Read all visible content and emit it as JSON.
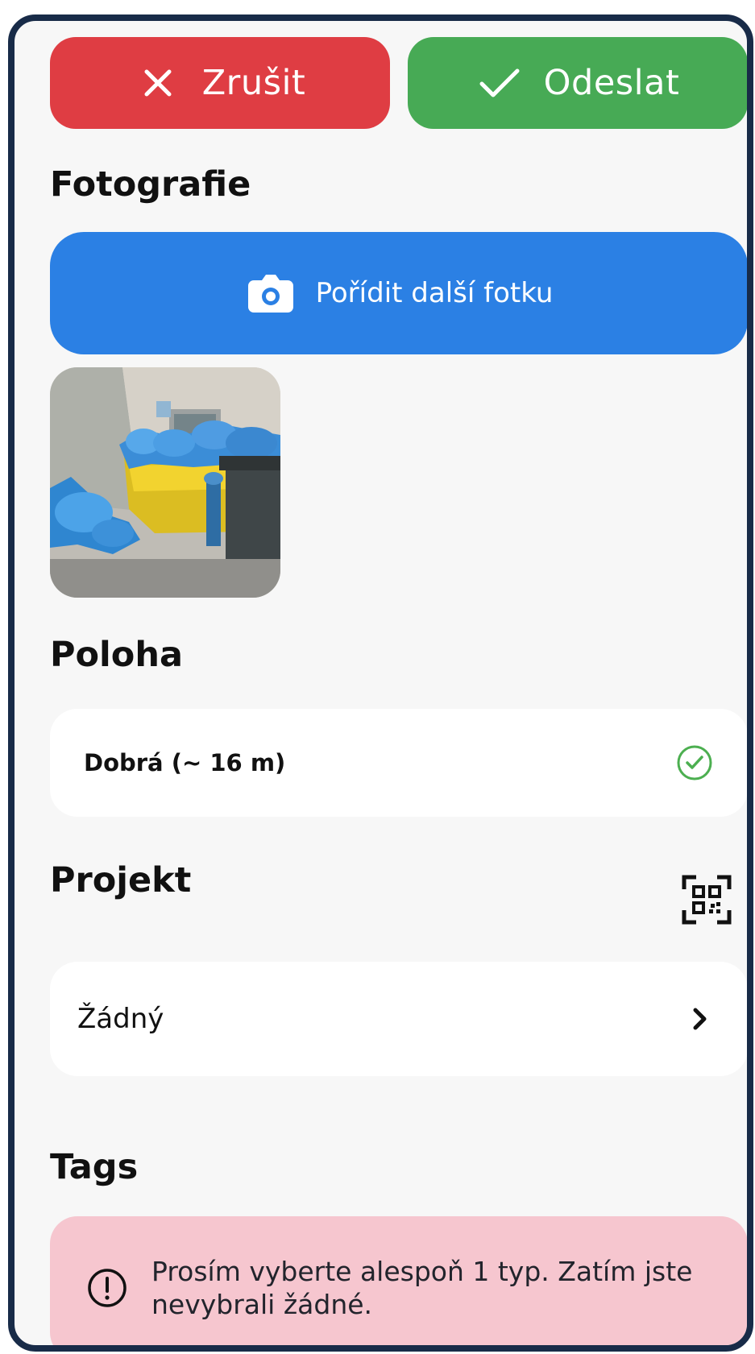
{
  "actions": {
    "cancel_label": "Zrušit",
    "send_label": "Odeslat"
  },
  "photos": {
    "title": "Fotografie",
    "take_photo_label": "Pořídit další fotku"
  },
  "location": {
    "title": "Poloha",
    "status_text": "Dobrá (~ 16 m)"
  },
  "project": {
    "title": "Projekt",
    "selected_value": "Žádný"
  },
  "tags": {
    "title": "Tags",
    "warning_text": "Prosím vyberte alespoň 1 typ. Zatím jste nevybrali žádné."
  },
  "icons": {
    "cancel": "close-icon",
    "send": "check-icon",
    "camera": "camera-icon",
    "location_status": "check-circle-icon",
    "project_scan": "qr-scan-icon",
    "project_chevron": "chevron-right-icon",
    "warning": "exclamation-circle-icon"
  },
  "colors": {
    "cancel": "#df3d43",
    "send": "#47aa55",
    "primary": "#2b80e4",
    "warning_background": "#f6c6cf",
    "frame_border": "#182b48"
  }
}
